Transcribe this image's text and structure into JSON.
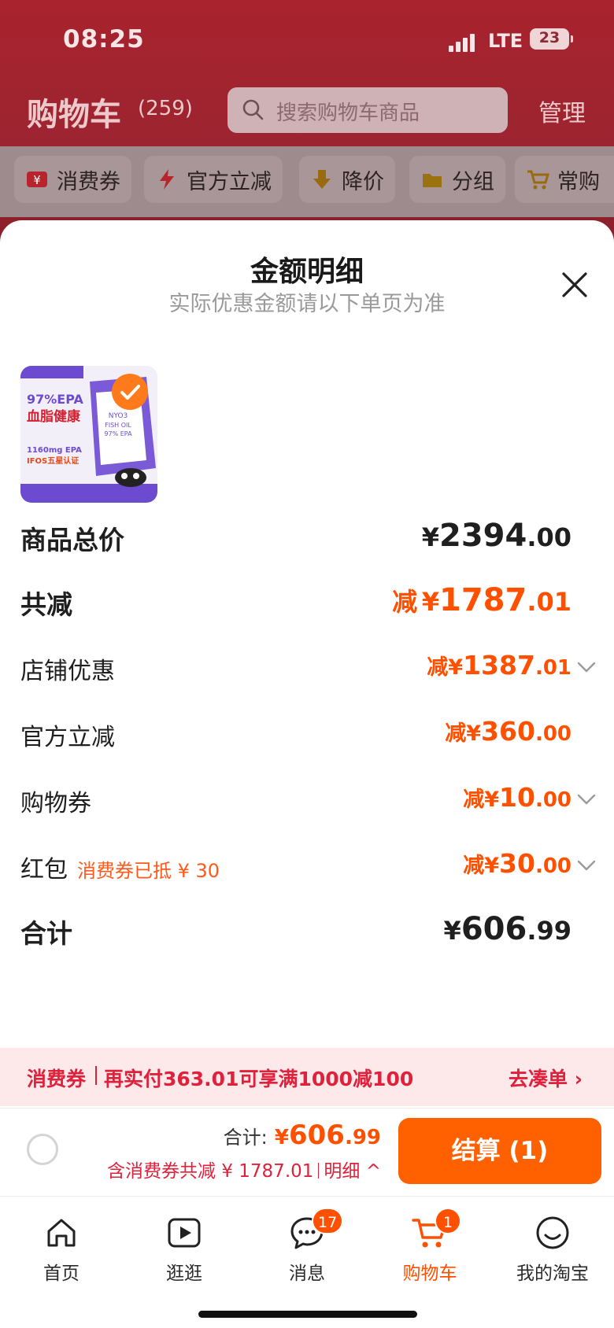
{
  "status_bar": {
    "time": "08:25",
    "network": "LTE",
    "battery": "23"
  },
  "header": {
    "title": "购物车",
    "count": "(259)",
    "search_placeholder": "搜索购物车商品",
    "manage_label": "管理"
  },
  "filters": [
    {
      "label": "消费券",
      "icon": "coupon-icon"
    },
    {
      "label": "官方立减",
      "icon": "lightning-icon"
    },
    {
      "label": "降价",
      "icon": "price-drop-icon"
    },
    {
      "label": "分组",
      "icon": "folder-icon"
    },
    {
      "label": "常购",
      "icon": "cart-icon"
    }
  ],
  "sheet": {
    "title": "金额明细",
    "subtitle": "实际优惠金额请以下单页为准",
    "product": {
      "image_text": [
        "97%EPA",
        "血脂健康",
        "NYO3",
        "FISH OIL",
        "97% EPA",
        "1160mg EPA",
        "IFOS五星认证"
      ]
    },
    "rows": [
      {
        "label": "商品总价",
        "prefix": "",
        "symbol": "¥",
        "int": "2394",
        "dec": ".00",
        "emphasis": true,
        "color": "#1f1f1f"
      },
      {
        "label": "共减",
        "prefix": "减",
        "symbol": "¥",
        "int": "1787",
        "dec": ".01",
        "emphasis": true,
        "color": "#ff5000"
      },
      {
        "label": "店铺优惠",
        "prefix": "减",
        "symbol": "¥",
        "int": "1387",
        "dec": ".01",
        "emphasis": false,
        "color": "#ff5000",
        "chevron": true
      },
      {
        "label": "官方立减",
        "prefix": "减",
        "symbol": "¥",
        "int": "360",
        "dec": ".00",
        "emphasis": false,
        "color": "#ff5000"
      },
      {
        "label": "购物券",
        "prefix": "减",
        "symbol": "¥",
        "int": "10",
        "dec": ".00",
        "emphasis": false,
        "color": "#ff5000",
        "chevron": true
      },
      {
        "label": "红包",
        "note": "消费券已抵 ¥ 30",
        "prefix": "减",
        "symbol": "¥",
        "int": "30",
        "dec": ".00",
        "emphasis": false,
        "color": "#ff5000",
        "chevron": true
      },
      {
        "label": "合计",
        "prefix": "",
        "symbol": "¥",
        "int": "606",
        "dec": ".99",
        "emphasis": true,
        "color": "#1f1f1f"
      }
    ]
  },
  "coupon_strip": {
    "label": "消费券",
    "message": "再实付363.01可享满1000减100",
    "action": "去凑单 ›"
  },
  "checkout": {
    "total_label": "合计:",
    "symbol": "¥",
    "total_int": "606",
    "total_dec": ".99",
    "discount_text": "含消费券共减 ¥ 1787.01",
    "detail_label": "明细 ^",
    "button_label": "结算 (1)"
  },
  "tabbar": [
    {
      "label": "首页",
      "icon": "home-icon",
      "badge": ""
    },
    {
      "label": "逛逛",
      "icon": "video-play-icon",
      "badge": ""
    },
    {
      "label": "消息",
      "icon": "chat-icon",
      "badge": "17"
    },
    {
      "label": "购物车",
      "icon": "cart-icon",
      "badge": "1",
      "active": true
    },
    {
      "label": "我的淘宝",
      "icon": "profile-icon",
      "badge": ""
    }
  ],
  "colors": {
    "accent": "#ff5000",
    "brand_red": "#a8232e",
    "coupon_red": "#e0213c"
  }
}
